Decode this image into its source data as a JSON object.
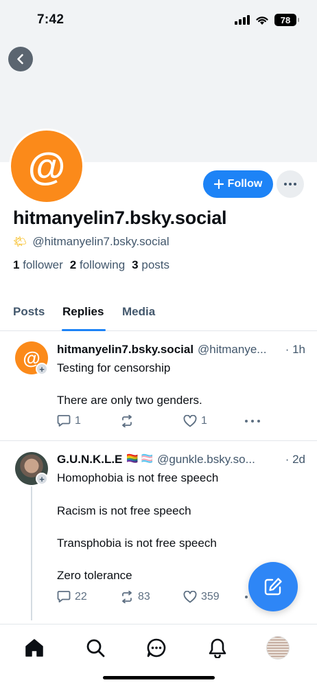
{
  "status_bar": {
    "time": "7:42",
    "battery": "78"
  },
  "profile": {
    "avatar_glyph": "@",
    "display_name": "hitmanyelin7.bsky.social",
    "handle": "@hitmanyelin7.bsky.social",
    "handle_emoji": "🌤",
    "follow_label": "Follow",
    "stats": {
      "followers_count": "1",
      "followers_label": "follower",
      "following_count": "2",
      "following_label": "following",
      "posts_count": "3",
      "posts_label": "posts"
    },
    "accent_color": "#1d83f6"
  },
  "tabs": [
    {
      "label": "Posts",
      "active": false
    },
    {
      "label": "Replies",
      "active": true
    },
    {
      "label": "Media",
      "active": false
    }
  ],
  "posts": [
    {
      "author_name": "hitmanyelin7.bsky.social",
      "author_handle": "@hitmanye...",
      "time": "· 1h",
      "lines": [
        "Testing for censorship",
        "There are only two genders."
      ],
      "replies": "1",
      "reposts": "",
      "likes": "1"
    },
    {
      "author_name": "G.U.N.K.L.E",
      "author_flags": "🏳️‍🌈 🏳️‍⚧️",
      "author_handle": "@gunkle.bsky.so...",
      "time": "· 2d",
      "lines": [
        "Homophobia is not free speech",
        "Racism is not free speech",
        "Transphobia is not free speech",
        "Zero tolerance"
      ],
      "replies": "22",
      "reposts": "83",
      "likes": "359"
    }
  ],
  "icons": {
    "back": "chevron-left-icon",
    "follow": "plus-icon",
    "more": "ellipsis-icon",
    "compose": "compose-icon",
    "nav": [
      "home-icon",
      "search-icon",
      "chat-icon",
      "bell-icon",
      "profile-avatar"
    ]
  }
}
